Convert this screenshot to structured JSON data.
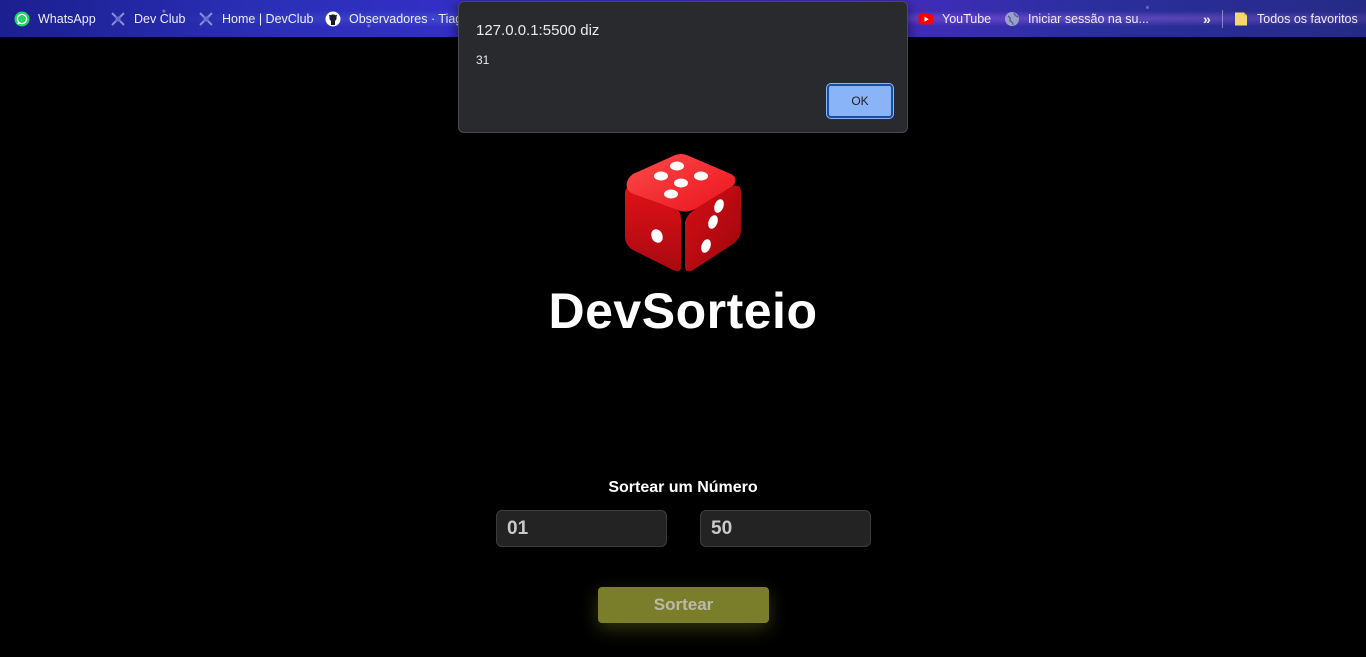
{
  "bookmarks": {
    "items": [
      {
        "label": "WhatsApp",
        "icon": "whatsapp-icon"
      },
      {
        "label": "Dev Club",
        "icon": "devclub-icon"
      },
      {
        "label": "Home | DevClub",
        "icon": "devclub-icon"
      },
      {
        "label": "Observadores · Tiag...",
        "icon": "github-icon"
      },
      {
        "label": "YouTube",
        "icon": "youtube-icon"
      },
      {
        "label": "Iniciar sessão na su...",
        "icon": "globe-icon"
      }
    ],
    "overflow": "»",
    "all_favorites": "Todos os favoritos"
  },
  "dialog": {
    "origin": "127.0.0.1:5500 diz",
    "message": "31",
    "ok_label": "OK"
  },
  "page": {
    "title": "DevSorteio",
    "label": "Sortear um Número",
    "min_value": "01",
    "max_value": "50",
    "button_label": "Sortear"
  },
  "colors": {
    "background": "#000000",
    "dice": "#e8141b",
    "button": "#7a7d2a",
    "dialog": "#292a2d",
    "ok_button": "#8ab4f8"
  }
}
